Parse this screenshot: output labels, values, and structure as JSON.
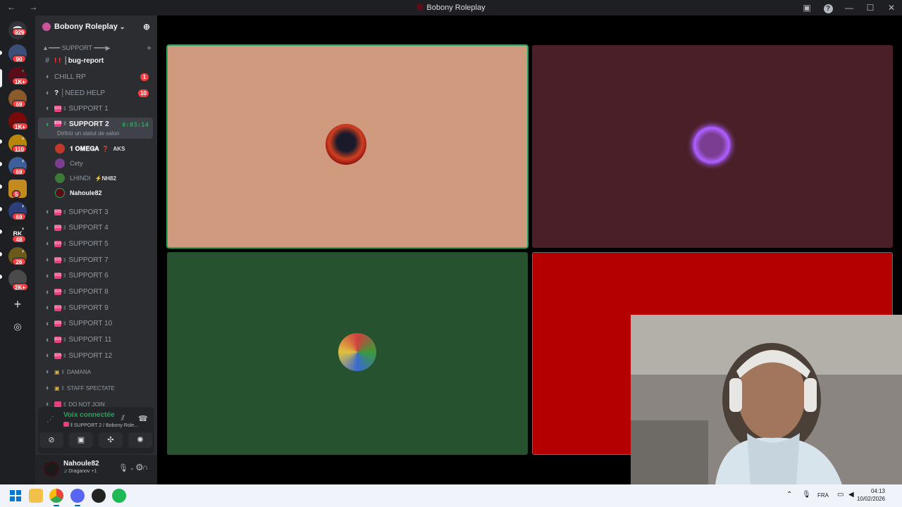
{
  "window": {
    "title": "Bobony Roleplay",
    "nav_arrows": "← →",
    "help_glyph": "?"
  },
  "guild_badges": [
    "929",
    "90",
    "1K+",
    "69",
    "1K+",
    "110",
    "69",
    "5",
    "69",
    "48",
    "26",
    "2K+"
  ],
  "server": {
    "name": "Bobony Roleplay",
    "chevron": "⌄",
    "category": "▲━━━ SUPPORT ━━━▶"
  },
  "channels": {
    "bug_report": "│bug-report",
    "bug_marks": "! !",
    "chill": "CHILL RP",
    "chill_badge": "1",
    "need_help": "│NEED HELP",
    "need_help_badge": "10",
    "need_help_mark": "?",
    "support_1": "SUPPORT 1",
    "support_2": "SUPPORT 2",
    "support_2_time": "6:03:14",
    "support_2_status": "Définir un statut de salon",
    "support_list": [
      "SUPPORT 3",
      "SUPPORT 4",
      "SUPPORT 5",
      "SUPPORT 7",
      "SUPPORT 6",
      "SUPPORT 8",
      "SUPPORT 9",
      "SUPPORT 10",
      "SUPPORT 11",
      "SUPPORT 12"
    ],
    "damana": "DAMANA",
    "staff_spectate": "STAFF SPECTATE",
    "do_not_join": "DO NOT JOIN"
  },
  "voice_members": [
    {
      "name": "𝟏 𝐎𝐌𝐄𝐆𝐀",
      "mark": "❓",
      "tag": "AKS",
      "color": "#c0392b"
    },
    {
      "name": "Cety",
      "mark": "",
      "tag": "",
      "color": "#7a3d8f"
    },
    {
      "name": "LHINDI",
      "mark": "",
      "tag": "⚡NH82",
      "color": "#3c7a3a"
    },
    {
      "name": "Nahoule82",
      "mark": "",
      "tag": "",
      "color": "#5a0d19"
    }
  ],
  "voice_panel": {
    "status": "Voix connectée",
    "channel": "SUPPORT 2 / Bobony Role...",
    "icons": [
      "signal-icon",
      "noise-suppression-icon",
      "disconnect-icon"
    ],
    "buttons": [
      "camera-off-icon",
      "screen-share-icon",
      "activities-icon",
      "soundboard-icon"
    ]
  },
  "user": {
    "name": "Nahoule82",
    "activity": "Draganov +1"
  },
  "tiles": [
    {
      "member": "𝟏 𝐎𝐌𝐄𝐆𝐀",
      "bg": "#d09a7e",
      "speaking": true
    },
    {
      "member": "Cety",
      "bg": "#4a1f27",
      "speaking": false
    },
    {
      "member": "LHINDI",
      "bg": "#275230",
      "speaking": false
    },
    {
      "member": "Nahoule82",
      "bg": "#b40000",
      "speaking": false
    }
  ],
  "taskbar": {
    "language": "FRA",
    "time": "04:13",
    "date": "10/02/2026",
    "apps": [
      "windows-start-icon",
      "file-explorer-icon",
      "chrome-icon",
      "discord-icon",
      "app-icon",
      "spotify-icon"
    ]
  },
  "colors": {
    "accent_green": "#23a55a",
    "badge_red": "#f23f43",
    "sidebar": "#2b2d31"
  }
}
